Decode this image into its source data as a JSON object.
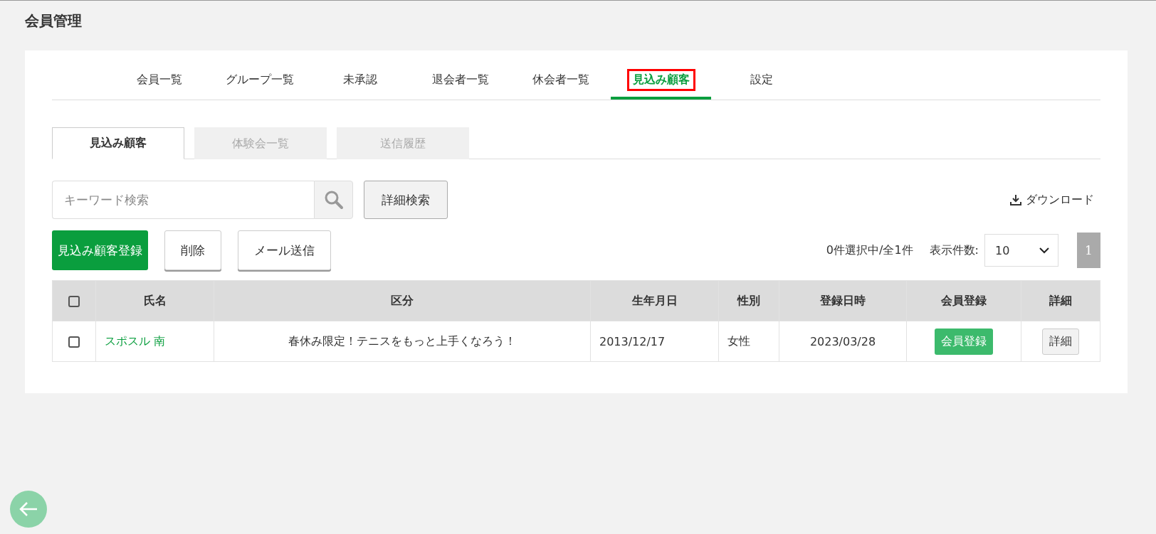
{
  "page_title": "会員管理",
  "tabs": [
    {
      "label": "会員一覧",
      "selected": false
    },
    {
      "label": "グループ一覧",
      "selected": false
    },
    {
      "label": "未承認",
      "selected": false
    },
    {
      "label": "退会者一覧",
      "selected": false
    },
    {
      "label": "休会者一覧",
      "selected": false
    },
    {
      "label": "見込み顧客",
      "selected": true
    },
    {
      "label": "設定",
      "selected": false
    }
  ],
  "sub_tabs": [
    {
      "label": "見込み顧客",
      "selected": true
    },
    {
      "label": "体験会一覧",
      "selected": false
    },
    {
      "label": "送信履歴",
      "selected": false
    }
  ],
  "search": {
    "placeholder": "キーワード検索"
  },
  "advanced_search_button": "詳細検索",
  "download_link": "ダウンロード",
  "actions": [
    {
      "label": "見込み顧客登録",
      "kind": "primary"
    },
    {
      "label": "削除",
      "kind": "plain"
    },
    {
      "label": "メール送信",
      "kind": "plain"
    }
  ],
  "selection_count": "0件選択中/全1件",
  "page_size": {
    "label": "表示件数:",
    "value": "10"
  },
  "pages": [
    {
      "label": "1",
      "selected": true
    }
  ],
  "table": {
    "select_all_checked": false,
    "columns": [
      "氏名",
      "区分",
      "生年月日",
      "性別",
      "登録日時",
      "会員登録",
      "詳細"
    ],
    "rows": [
      {
        "checked": false,
        "name": "スポスル 南",
        "category": "春休み限定！テニスをもっと上手くなろう！",
        "birth_date": "2013/12/17",
        "gender": "女性",
        "registered_at": "2023/03/28",
        "register_button": "会員登録",
        "detail_button": "詳細"
      }
    ]
  }
}
